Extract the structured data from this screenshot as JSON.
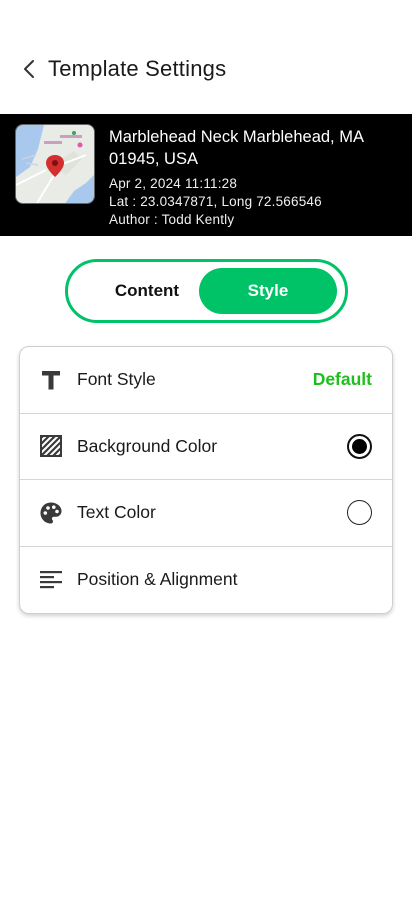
{
  "header": {
    "title": "Template Settings",
    "back_icon": "chevron-left-icon"
  },
  "preview": {
    "address": "Marblehead Neck  Marblehead, MA 01945, USA",
    "datetime": "Apr 2, 2024 11:11:28",
    "coords": "Lat : 23.0347871, Long 72.566546",
    "author": "Author : Todd Kently",
    "map_icon": "map-thumbnail",
    "pin_color": "#d32f2f"
  },
  "tabs": {
    "content_label": "Content",
    "style_label": "Style",
    "active": "Style",
    "accent_color": "#00c267"
  },
  "settings": {
    "items": [
      {
        "label": "Font Style",
        "icon": "text-format-icon",
        "value": "Default"
      },
      {
        "label": "Background Color",
        "icon": "texture-icon",
        "color": "#000000"
      },
      {
        "label": "Text Color",
        "icon": "palette-icon",
        "color": "#ffffff"
      },
      {
        "label": "Position & Alignment",
        "icon": "align-left-icon"
      }
    ],
    "value_color": "#1fbf1f"
  }
}
